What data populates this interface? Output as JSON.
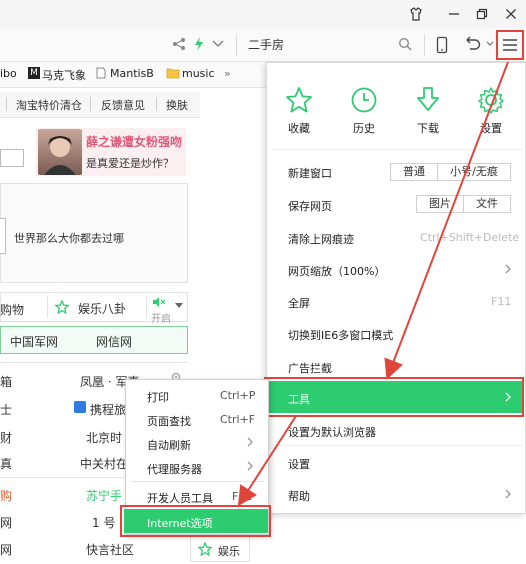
{
  "addressbar": {
    "search_text": "二手房"
  },
  "bookmarks": [
    {
      "label": "ibo"
    },
    {
      "label": "马克飞象"
    },
    {
      "label": "MantisB"
    },
    {
      "label": "music"
    },
    {
      "label": "»"
    }
  ],
  "page": {
    "links_row": [
      "淘宝特价清仓",
      "反馈意见",
      "换肤"
    ],
    "ad_title": "薛之谦遭女粉强吻",
    "ad_subtitle": "是真爱还是炒作？",
    "slogan": "世界那么大你都去过哪",
    "tab_left": "购物",
    "tab_ent": "娱乐八卦",
    "tab_open": "开启",
    "nav_links": [
      "中国军网",
      "网信网"
    ],
    "left_col": [
      "箱",
      "士",
      "财",
      "真",
      "购",
      "网",
      "网"
    ],
    "right_col": [
      "凤凰 · 军事",
      "携程旅",
      "北京时",
      "中关村在",
      "苏宁手",
      "1 号",
      "快言社区"
    ],
    "bottom_tab": "娱乐"
  },
  "menu": {
    "quick_actions": [
      {
        "icon": "star-icon",
        "label": "收藏"
      },
      {
        "icon": "clock-icon",
        "label": "历史"
      },
      {
        "icon": "download-icon",
        "label": "下载"
      },
      {
        "icon": "gear-icon",
        "label": "设置"
      }
    ],
    "new_window": "新建窗口",
    "new_window_normal": "普通",
    "new_window_private": "小号/无痕",
    "save_page": "保存网页",
    "save_image": "图片",
    "save_file": "文件",
    "clear_traces": "清除上网痕迹",
    "clear_shortcut": "Ctrl+Shift+Delete",
    "zoom": "网页缩放（100%）",
    "fullscreen": "全屏",
    "fullscreen_shortcut": "F11",
    "ie6_mode": "切换到IE6多窗口模式",
    "adblock": "广告拦截",
    "tools": "工具",
    "set_default": "设置为默认浏览器",
    "settings": "设置",
    "help": "帮助"
  },
  "submenu": {
    "print": "打印",
    "print_shortcut": "Ctrl+P",
    "find": "页面查找",
    "find_shortcut": "Ctrl+F",
    "auto_refresh": "自动刷新",
    "proxy": "代理服务器",
    "devtools": "开发人员工具",
    "devtools_shortcut": "F12",
    "internet_options": "Internet选项"
  },
  "colors": {
    "accent_green": "#2ecc71",
    "annotation_red": "#e0453b"
  }
}
